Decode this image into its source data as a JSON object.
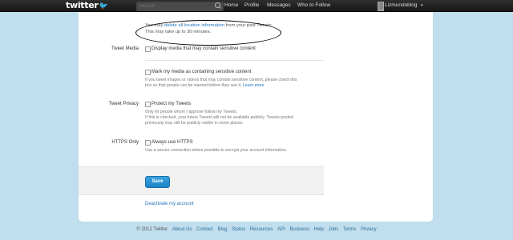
{
  "topbar": {
    "logo": "twitter",
    "search_placeholder": "Search",
    "nav": [
      "Home",
      "Profile",
      "Messages",
      "Who to Follow"
    ],
    "user_name": "Lizmundoblog",
    "caret": "▾"
  },
  "location": {
    "prefix": "You may ",
    "link": "delete all location information",
    "suffix": " from your past Tweets.",
    "note": "This may take up to 30 minutes."
  },
  "tweet_media": {
    "label": "Tweet Media",
    "display_sensitive": "Display media that may contain sensitive content",
    "mark_sensitive": "Mark my media as containing sensitive content",
    "help_line1": "If you tweet images or videos that may contain sensitive content, please check this",
    "help_line2_prefix": "box so that people can be warned before they see it. ",
    "learn_more": "Learn more"
  },
  "tweet_privacy": {
    "label": "Tweet Privacy",
    "checkbox_label": "Protect my Tweets",
    "help1": "Only let people whom I approve follow my Tweets.",
    "help2": "If this is checked, your future Tweets will not be available publicly. Tweets posted",
    "help3": "previously may still be publicly visible in some places."
  },
  "https": {
    "label": "HTTPS Only",
    "checkbox_label": "Always use HTTPS",
    "help": "Use a secure connection where possible to encrypt your account information."
  },
  "save_label": "Save",
  "deactivate_label": "Deactivate my account",
  "footer": {
    "copyright": "© 2012 Twitter",
    "links": [
      "About Us",
      "Contact",
      "Blog",
      "Status",
      "Resources",
      "API",
      "Business",
      "Help",
      "Jobs",
      "Terms",
      "Privacy"
    ]
  },
  "colors": {
    "accent": "#2276bb",
    "background": "#c0deed",
    "topbar": "#222222"
  }
}
